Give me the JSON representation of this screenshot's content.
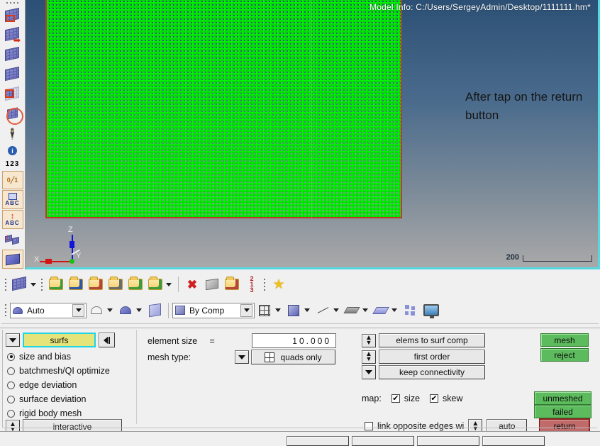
{
  "viewport": {
    "model_info": "Model Info: C:/Users/SergeyAdmin/Desktop/1111111.hm*",
    "annotation": "After tap on the return button",
    "axis": {
      "x": "X",
      "y": "Y",
      "z": "Z"
    },
    "scale_value": "200",
    "background_top_color": "#2c5075",
    "background_bottom_color": "#a9a9a9",
    "mesh_color": "#00e600",
    "mesh_border_color": "#c0392b",
    "border_accent_color": "#55d9e0"
  },
  "left_toolbar": {
    "items": [
      {
        "name": "2d-automesh-icon",
        "label": "2D AutoMesh"
      },
      {
        "name": "mesh-edit-icon",
        "label": "Edit Element"
      },
      {
        "name": "mesh-quality-icon",
        "label": "Quality Index"
      },
      {
        "name": "mesh-display-icon",
        "label": "Element Display"
      },
      {
        "name": "mesh-checker-icon",
        "label": "Checks"
      },
      {
        "name": "mesh-circle-icon",
        "label": "Mask"
      },
      {
        "name": "binoculars-icon",
        "label": "Find"
      },
      {
        "name": "info-icon",
        "label": "Info"
      },
      {
        "name": "numbers-icon",
        "label": "Numbers"
      },
      {
        "name": "distance-icon",
        "label": "Distance"
      },
      {
        "name": "text-abc-icon",
        "label": "Text Markup"
      },
      {
        "name": "dimension-abc-icon",
        "label": "Dimensioning"
      },
      {
        "name": "translate-icon",
        "label": "Translate"
      },
      {
        "name": "surface-icon",
        "label": "Surfaces"
      }
    ]
  },
  "toolbars": {
    "row1": [
      {
        "name": "mesh-tool-icon",
        "label": "Mesh",
        "has_caret": true
      },
      {
        "name": "import-solver-deck-icon",
        "label": "Import Solver Deck"
      },
      {
        "name": "import-geometry-icon",
        "label": "Import Geometry"
      },
      {
        "name": "export-icon",
        "label": "Export"
      },
      {
        "name": "thickness-icon",
        "label": "Thickness"
      },
      {
        "name": "import-down-icon",
        "label": "Import"
      },
      {
        "name": "connector-icon",
        "label": "Connectors",
        "has_caret": true
      },
      {
        "name": "delete-icon",
        "label": "Delete"
      },
      {
        "name": "organize-icon",
        "label": "Organize"
      },
      {
        "name": "component-icon",
        "label": "Component"
      },
      {
        "name": "renumber-icon",
        "label": "Renumber"
      },
      {
        "name": "favorites-star-icon",
        "label": "Favorites"
      }
    ],
    "row2": {
      "color_combo_value": "Auto",
      "comp_combo_value": "By Comp",
      "icons": [
        {
          "name": "surface-shade-icon",
          "has_caret": true
        },
        {
          "name": "surface-mesh-icon",
          "has_caret": true
        },
        {
          "name": "solid-cube-icon",
          "has_caret": false
        },
        {
          "name": "wireframe-cube-icon",
          "has_caret": true
        },
        {
          "name": "shaded-cube-icon",
          "has_caret": true
        },
        {
          "name": "line-icon",
          "has_caret": true
        },
        {
          "name": "shaded-plate-icon",
          "has_caret": true
        },
        {
          "name": "solid-plate-icon",
          "has_caret": true
        },
        {
          "name": "window-tile-icon",
          "has_caret": false
        },
        {
          "name": "monitor-icon",
          "has_caret": false
        }
      ]
    }
  },
  "panel": {
    "entity_selector": {
      "value": "surfs",
      "dropdown_name": "entity-type-dropdown",
      "back_button_name": "reset-selection-button"
    },
    "mesh_method_options": [
      {
        "label": "size and bias",
        "selected": true
      },
      {
        "label": "batchmesh/QI optimize",
        "selected": false
      },
      {
        "label": "edge deviation",
        "selected": false
      },
      {
        "label": "surface deviation",
        "selected": false
      },
      {
        "label": "rigid body mesh",
        "selected": false
      }
    ],
    "mode_button": "interactive",
    "element_size": {
      "label": "element size",
      "equals": "=",
      "value": "10.000"
    },
    "mesh_type": {
      "label": "mesh type:",
      "value": "quads only"
    },
    "option_buttons": [
      {
        "label": "elems to surf comp",
        "control": "spinner"
      },
      {
        "label": "first order",
        "control": "spinner"
      },
      {
        "label": "keep connectivity",
        "control": "dropdown"
      }
    ],
    "map": {
      "label": "map:",
      "checkboxes": [
        {
          "label": "size",
          "checked": true
        },
        {
          "label": "skew",
          "checked": true
        }
      ]
    },
    "link_opposite": {
      "label": "link opposite edges wi",
      "checked": false,
      "auto_label": "auto"
    },
    "action_buttons": [
      {
        "label": "mesh",
        "style": "green"
      },
      {
        "label": "reject",
        "style": "green"
      }
    ],
    "status_buttons": [
      {
        "label": "unmeshed",
        "style": "green"
      },
      {
        "label": "failed",
        "style": "green"
      },
      {
        "label": "return",
        "style": "red"
      }
    ]
  }
}
